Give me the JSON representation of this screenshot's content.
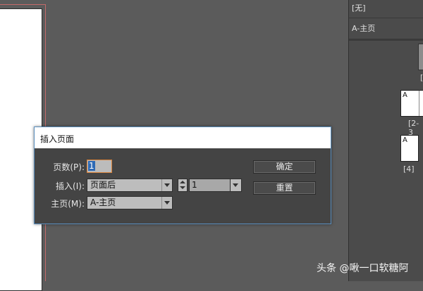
{
  "right_panel": {
    "none_label": "[无]",
    "master_label": "A-主页",
    "page_cut_label": "[",
    "spread_page_letter": "A",
    "spread_label": "[2-3",
    "single_page_letter": "A",
    "single_label": "[4]"
  },
  "dialog": {
    "title": "插入页面",
    "pages_label": "页数(P):",
    "pages_value": "1",
    "insert_label": "插入(I):",
    "insert_position": "页面后",
    "insert_page_number": "1",
    "master_label": "主页(M):",
    "master_value": "A-主页",
    "ok_button": "确定",
    "reset_button": "重置"
  },
  "watermark": "头条 @啾一口软糖阿",
  "colors": {
    "dialog_border": "#5a8fbf",
    "focus_border": "#d9823a",
    "selection": "#2f6ab5"
  }
}
